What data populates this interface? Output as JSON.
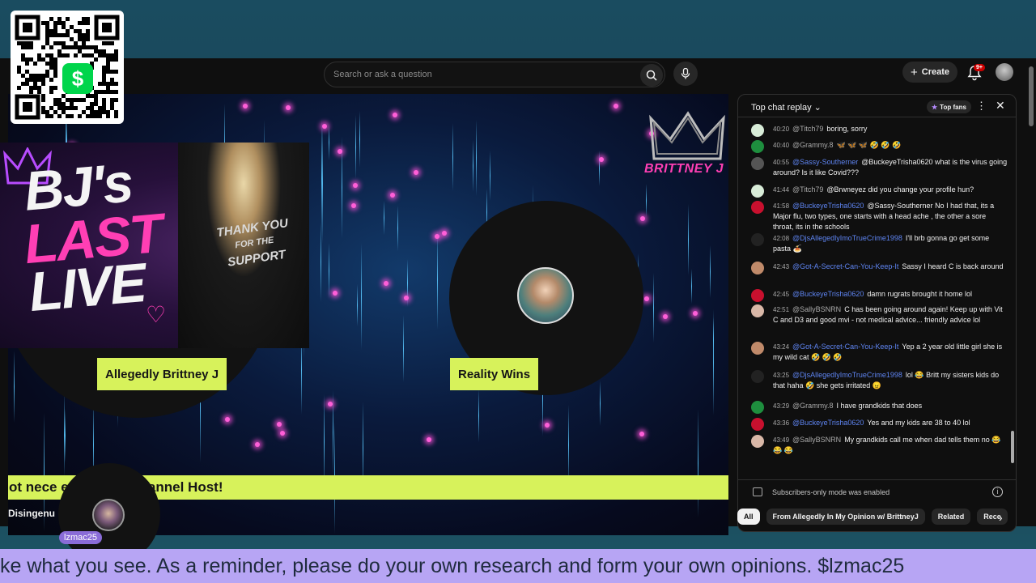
{
  "search": {
    "placeholder": "Search or ask a question"
  },
  "header": {
    "create_label": "Create",
    "notif_badge": "9+"
  },
  "qr": {
    "cash_symbol": "$"
  },
  "video": {
    "host_name": "Allegedly Brittney J",
    "guest_name": "Reality Wins",
    "brand": "BRITTNEY J",
    "ticker": "ot nece              ews of the channel Host!"
  },
  "thumbnail": {
    "line1": "BJ's",
    "line2": "LAST",
    "line3": "LIVE",
    "jacket1": "THANK YOU",
    "jacket2": "FOR THE",
    "jacket3": "SUPPORT"
  },
  "channel": {
    "name": "Disingenu"
  },
  "commenter": {
    "username": "lzmac25"
  },
  "chat": {
    "title": "Top chat replay",
    "top_fans": "Top fans",
    "footer": "Subscribers-only mode was enabled",
    "messages": [
      {
        "time": "40:20",
        "author": "@Titch79",
        "text": "boring, sorry",
        "mod": false,
        "color": "#d8ecd8"
      },
      {
        "time": "40:40",
        "author": "@Grammy.8",
        "text": "🦋 🦋 🦋 🤣 🤣 🤣",
        "mod": false,
        "color": "#1e8e3e"
      },
      {
        "time": "40:55",
        "author": "@Sassy-Southerner",
        "text": "@BuckeyeTrisha0620 what is the virus going around? Is it like Covid???",
        "mod": true,
        "color": "#555555"
      },
      {
        "time": "41:44",
        "author": "@Titch79",
        "text": "@Brwneyez did you change your profile hun?",
        "mod": false,
        "color": "#d8ecd8"
      },
      {
        "time": "41:58",
        "author": "@BuckeyeTrisha0620",
        "text": "@Sassy-Southerner No I had that, its a Major flu, two types, one starts with a head ache , the other a sore throat, its in the schools",
        "mod": true,
        "color": "#c8102e"
      },
      {
        "time": "42:08",
        "author": "@DjsAllegedlyImoTrueCrime1998",
        "text": "I'll brb gonna go get some pasta 🍝",
        "mod": true,
        "color": "#222222"
      },
      {
        "time": "42:43",
        "author": "@Got-A-Secret-Can-You-Keep-It",
        "text": "Sassy I heard C is back around",
        "mod": true,
        "color": "#c08a6a"
      },
      {
        "time": "42:45",
        "author": "@BuckeyeTrisha0620",
        "text": "damn rugrats brought it home lol",
        "mod": true,
        "color": "#c8102e"
      },
      {
        "time": "42:51",
        "author": "@SallyBSNRN",
        "text": "C has been going around again! Keep up with Vit C and D3 and good mvi - not medical advice... friendly advice lol",
        "mod": false,
        "color": "#d9b8a8"
      },
      {
        "time": "43:24",
        "author": "@Got-A-Secret-Can-You-Keep-It",
        "text": "Yep a 2 year old little girl she is my wild cat 🤣 🤣 🤣",
        "mod": true,
        "color": "#c08a6a"
      },
      {
        "time": "43:25",
        "author": "@DjsAllegedlyImoTrueCrime1998",
        "text": "lol 😂 Britt my sisters kids do that haha 🤣 she gets irritated 😠",
        "mod": true,
        "color": "#222222"
      },
      {
        "time": "43:29",
        "author": "@Grammy.8",
        "text": "I have grandkids that does",
        "mod": false,
        "color": "#1e8e3e"
      },
      {
        "time": "43:36",
        "author": "@BuckeyeTrisha0620",
        "text": "Yes and my kids are 38 to 40 lol",
        "mod": true,
        "color": "#c8102e"
      },
      {
        "time": "43:49",
        "author": "@SallyBSNRN",
        "text": "My grandkids call me when dad tells them no 😂 😂 😂",
        "mod": false,
        "color": "#d9b8a8"
      }
    ]
  },
  "chips": [
    "All",
    "From Allegedly In My Opinion w/ BrittneyJ",
    "Related",
    "Rece"
  ],
  "crawl": {
    "text": "ke what you see. As a reminder, please do your own research and form your own opinions. $lzmac25"
  },
  "colors": {
    "accent_lime": "#d7f25b",
    "crawl_bg": "#b7a5f4",
    "pink": "#ff3fb4",
    "mod_blue": "#5e84f1"
  }
}
